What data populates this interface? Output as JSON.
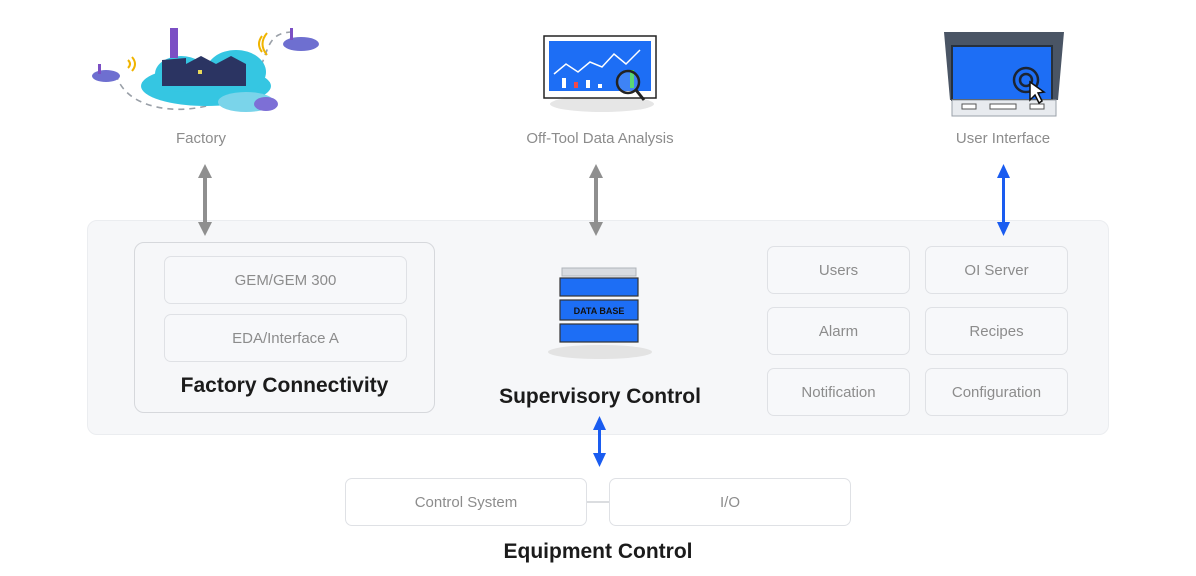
{
  "top_nodes": {
    "factory": "Factory",
    "off_tool": "Off-Tool Data Analysis",
    "user_interface": "User Interface"
  },
  "factory_connectivity": {
    "title": "Factory Connectivity",
    "items": [
      "GEM/GEM 300",
      "EDA/Interface A"
    ]
  },
  "supervisory_control": {
    "title": "Supervisory Control",
    "db_label": "DATA BASE"
  },
  "modules": [
    "Users",
    "OI Server",
    "Alarm",
    "Recipes",
    "Notification",
    "Configuration"
  ],
  "equipment_control": {
    "title": "Equipment Control",
    "items": [
      "Control System",
      "I/O"
    ]
  },
  "colors": {
    "gray_arrow": "#8f8f8f",
    "blue_arrow": "#1a5cf0",
    "screen_blue": "#1d6ef5",
    "cloud_cyan": "#35c6e2",
    "factory_navy": "#2b3462",
    "chimney_purple": "#7b4fc4"
  }
}
